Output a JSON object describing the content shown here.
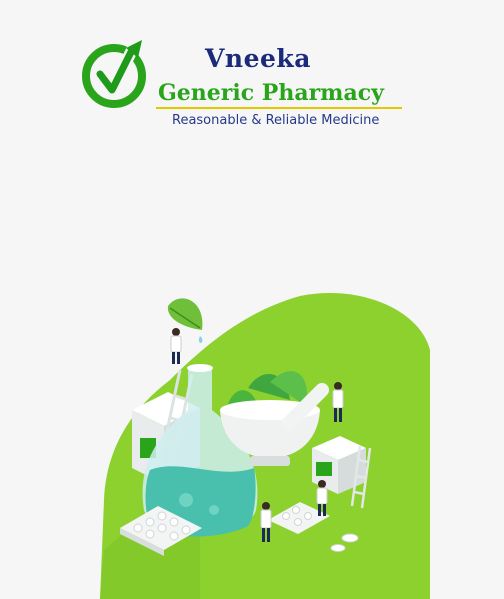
{
  "brand": {
    "name": "Vneeka",
    "subtitle": "Generic Pharmacy",
    "tagline": "Reasonable  &  Reliable Medicine",
    "logo_icon": "check-arrow-icon"
  },
  "illustration": {
    "icon": "pharmacy-lab-illustration"
  },
  "colors": {
    "brand_navy": "#1b2a7b",
    "brand_green": "#2aa51b",
    "accent_yellow": "#e3c800",
    "blob_green": "#8dd12f",
    "background": "#f6f6f6"
  }
}
